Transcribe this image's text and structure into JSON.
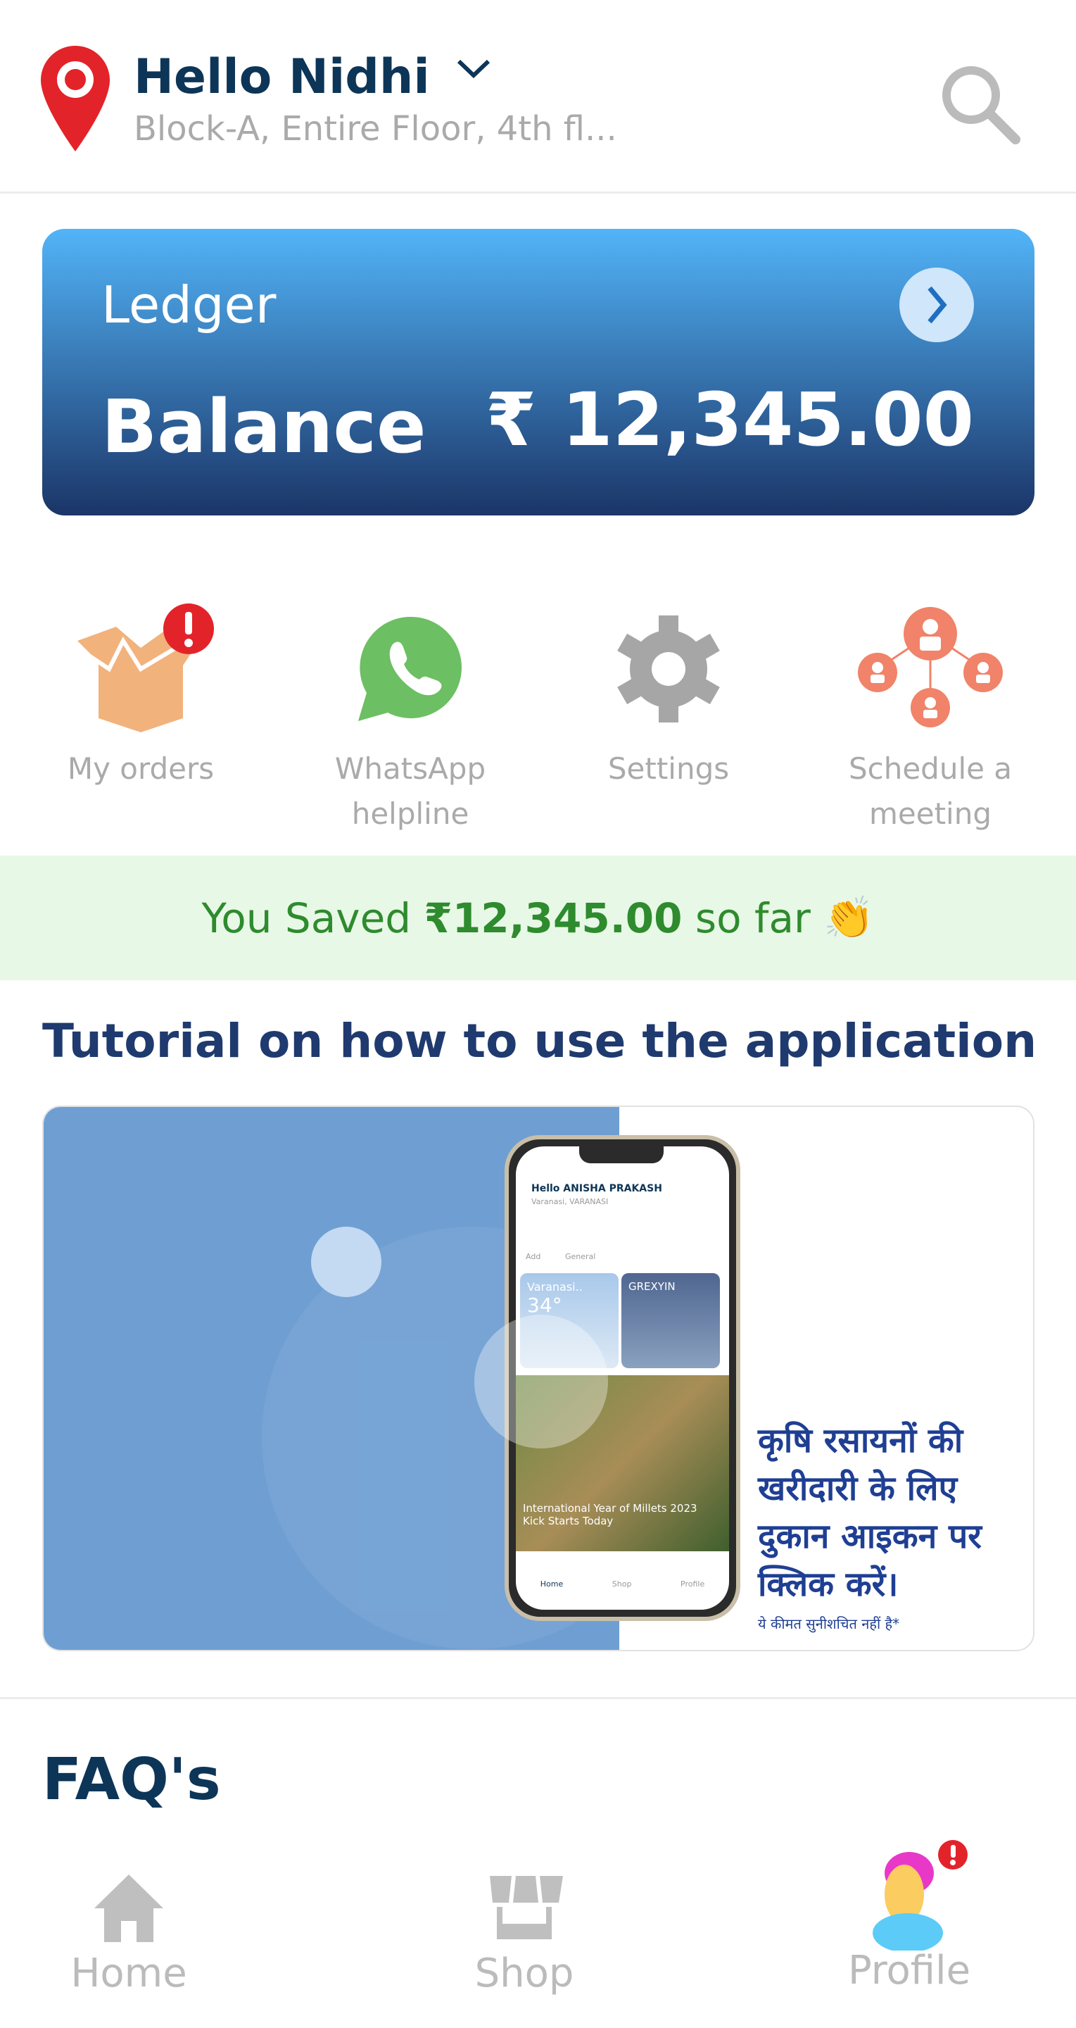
{
  "header": {
    "greeting": "Hello Nidhi",
    "address": "Block-A, Entire Floor, 4th fl...",
    "icons": [
      "location-pin-icon",
      "chevron-down-icon",
      "search-icon"
    ]
  },
  "ledger": {
    "title": "Ledger",
    "balance_label": "Balance",
    "balance_amount": "₹ 12,345.00"
  },
  "quick_actions": [
    {
      "label": "My orders",
      "icon": "box-icon",
      "alert": true
    },
    {
      "label": "WhatsApp helpline",
      "icon": "whatsapp-icon"
    },
    {
      "label": "Settings",
      "icon": "gear-icon"
    },
    {
      "label": "Schedule a meeting",
      "icon": "meeting-network-icon"
    }
  ],
  "savings": {
    "prefix": "You Saved ",
    "amount": "₹12,345.00",
    "suffix": " so far ",
    "emoji": "👏"
  },
  "tutorial": {
    "title": "Tutorial on how to use the application",
    "mock": {
      "greeting": "Hello ANISHA PRAKASH",
      "location": "Varanasi, VARANASI",
      "add": "Add",
      "general": "General",
      "weather_city": "Varanasi..",
      "temp": "34°",
      "brand": "GREXYIN",
      "news": "International Year of Millets 2023 Kick Starts Today",
      "nav_home": "Home",
      "nav_shop": "Shop",
      "nav_profile": "Profile"
    },
    "hindi_text": "कृषि रसायनों की खरीदारी के लिए दुकान आइकन पर क्लिक करें।",
    "disclaimer": "ये कीमत सुनीशचित नहीं है*"
  },
  "faq": {
    "title": "FAQ's"
  },
  "bottom_nav": [
    {
      "label": "Home",
      "icon": "home-icon"
    },
    {
      "label": "Shop",
      "icon": "shop-icon"
    },
    {
      "label": "Profile",
      "icon": "profile-icon",
      "alert": true
    }
  ],
  "colors": {
    "navy": "#0d3557",
    "accent_red": "#e3232a",
    "green": "#2e8b2e",
    "savings_bg": "#e8f8e6",
    "video_blue": "#6f9fd2"
  }
}
